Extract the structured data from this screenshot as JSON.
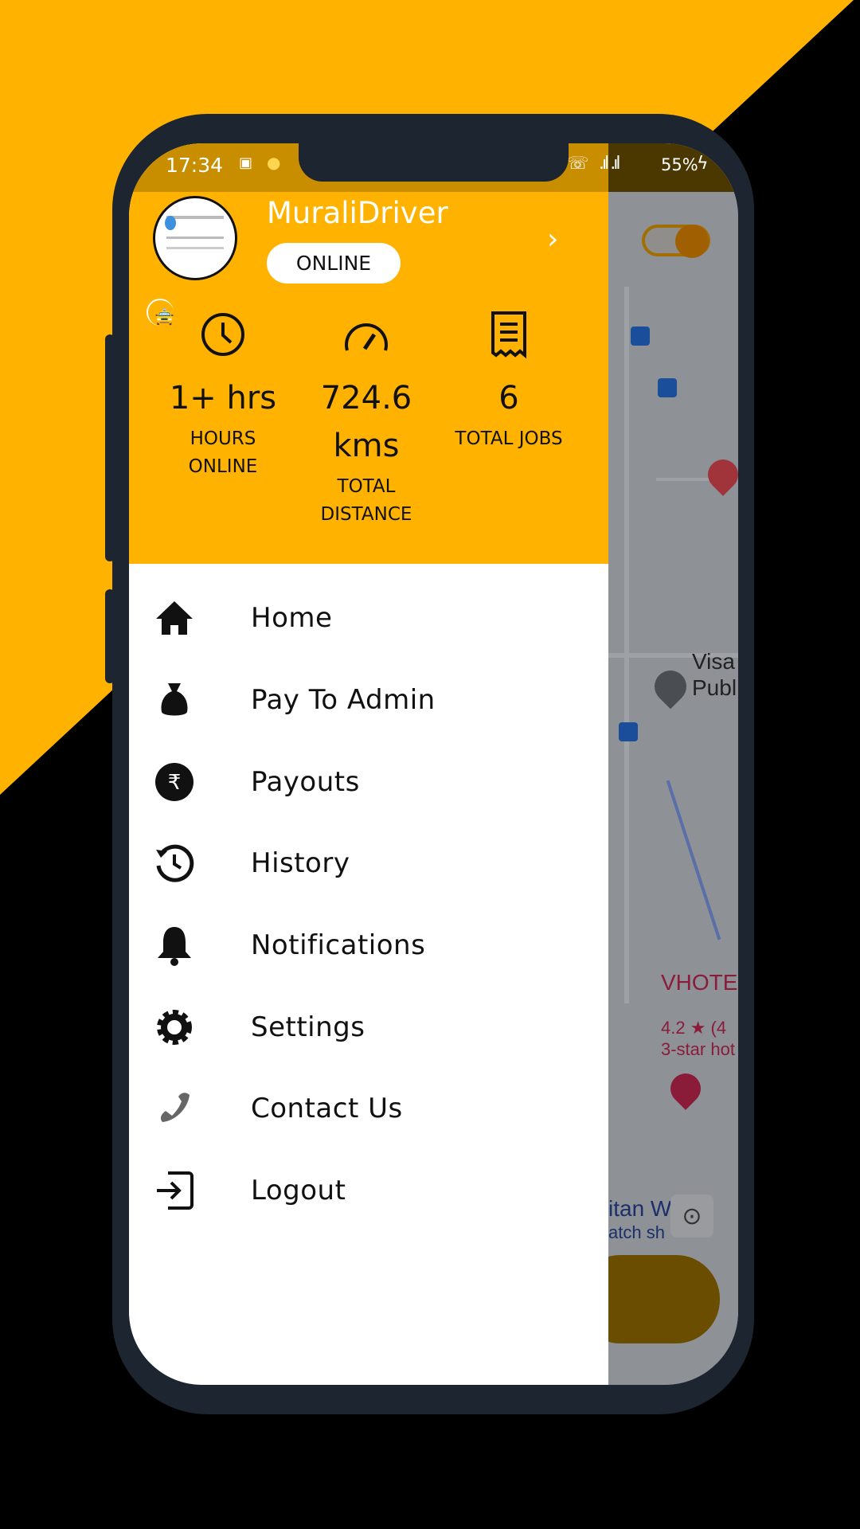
{
  "colors": {
    "accent": "#ffb300",
    "frame": "#1c2530"
  },
  "status_bar": {
    "time": "17:34",
    "battery": "55%"
  },
  "profile": {
    "name": "MuraliDriver",
    "status": "ONLINE"
  },
  "stats": [
    {
      "icon": "clock-icon",
      "value": "1+ hrs",
      "label_line1": "HOURS",
      "label_line2": "ONLINE"
    },
    {
      "icon": "speedometer-icon",
      "value": "724.6",
      "value_line2": "kms",
      "label_line1": "TOTAL",
      "label_line2": "DISTANCE"
    },
    {
      "icon": "receipt-icon",
      "value": "6",
      "label_line1": "TOTAL JOBS"
    }
  ],
  "menu": [
    {
      "label": "Home",
      "icon": "home-icon"
    },
    {
      "label": "Pay To Admin",
      "icon": "money-bag-icon"
    },
    {
      "label": "Payouts",
      "icon": "rupee-icon"
    },
    {
      "label": "History",
      "icon": "history-icon"
    },
    {
      "label": "Notifications",
      "icon": "bell-icon"
    },
    {
      "label": "Settings",
      "icon": "gear-icon"
    },
    {
      "label": "Contact Us",
      "icon": "phone-icon"
    },
    {
      "label": "Logout",
      "icon": "logout-icon"
    }
  ],
  "map": {
    "place1": "Visa",
    "place1b": "Publ",
    "hotel": "VHOTE",
    "rating": "4.2 ★ (4",
    "hotel_type": "3-star hot",
    "shop": "itan W",
    "shop2": "atch sh"
  }
}
